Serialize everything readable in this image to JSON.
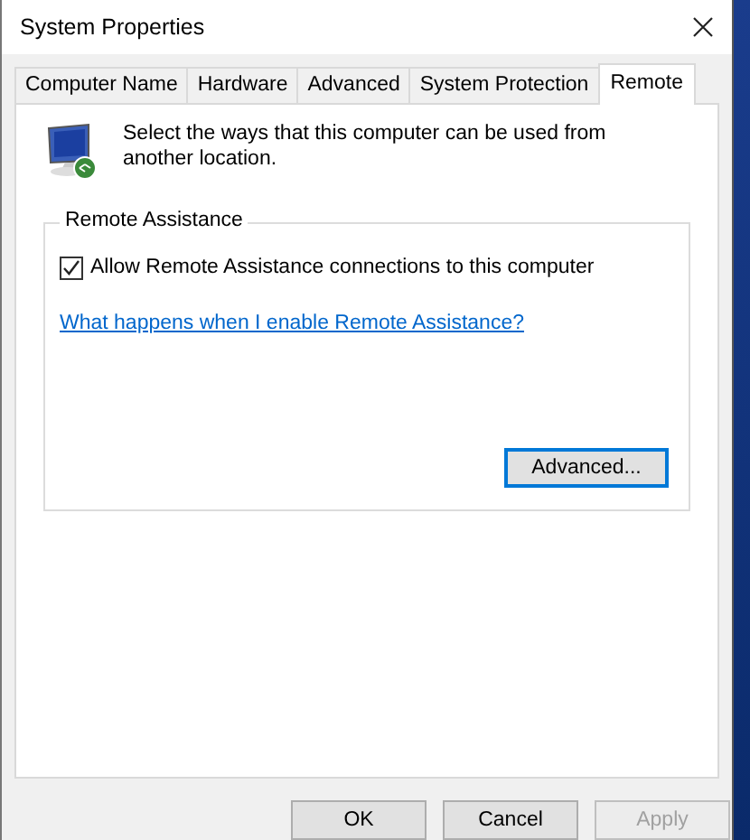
{
  "window": {
    "title": "System Properties"
  },
  "tabs": [
    {
      "label": "Computer Name",
      "selected": false
    },
    {
      "label": "Hardware",
      "selected": false
    },
    {
      "label": "Advanced",
      "selected": false
    },
    {
      "label": "System Protection",
      "selected": false
    },
    {
      "label": "Remote",
      "selected": true
    }
  ],
  "intro": "Select the ways that this computer can be used from another location.",
  "remote_assistance": {
    "title": "Remote Assistance",
    "checkbox": {
      "label": "Allow Remote Assistance connections to this computer",
      "checked": true
    },
    "link": "What happens when I enable Remote Assistance?",
    "button": "Advanced..."
  },
  "buttons": [
    {
      "label": "OK",
      "disabled": false
    },
    {
      "label": "Cancel",
      "disabled": false
    },
    {
      "label": "Apply",
      "disabled": true
    }
  ]
}
